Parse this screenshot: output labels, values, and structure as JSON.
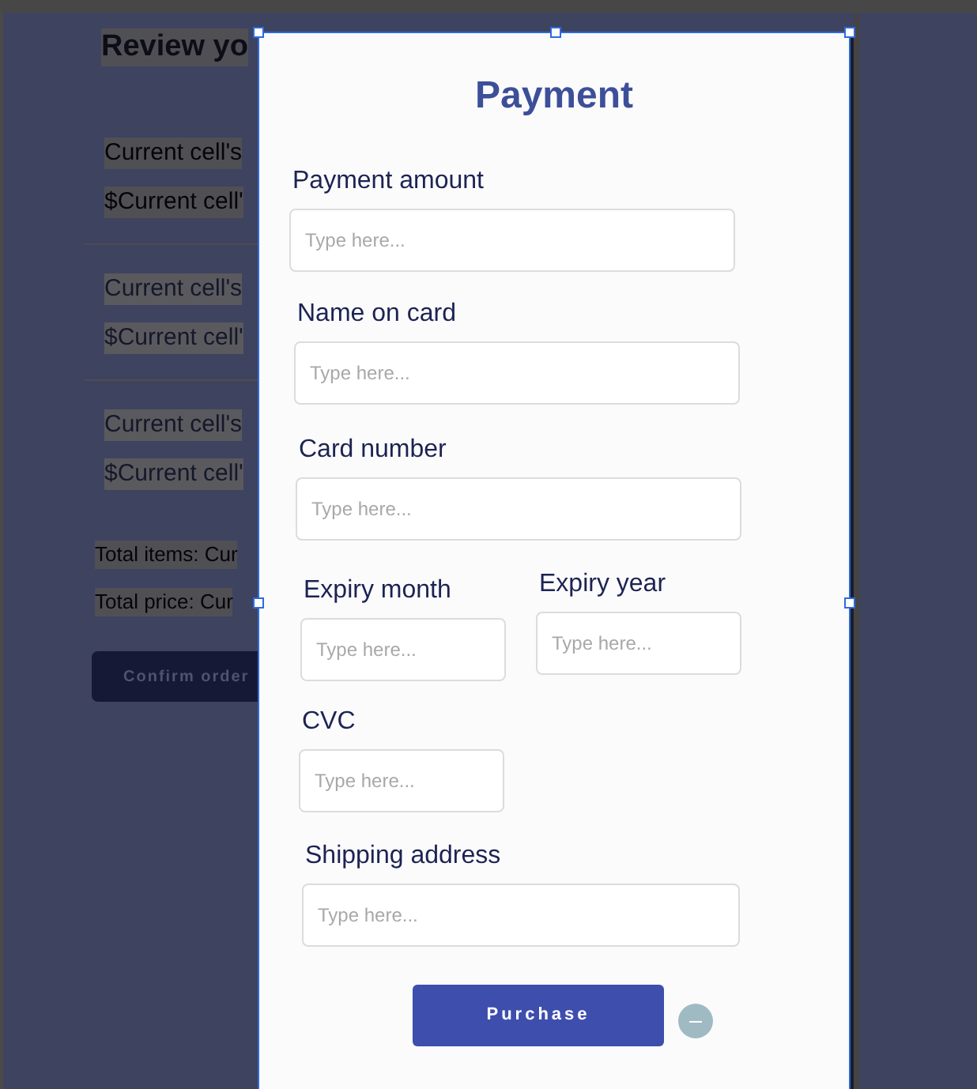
{
  "background_screen": {
    "title": "Review yo",
    "items": [
      {
        "name": "Current cell's",
        "price": "$Current cell'",
        "faded": false
      },
      {
        "name": "Current cell's",
        "price": "$Current cell'",
        "faded": true
      },
      {
        "name": "Current cell's",
        "price": "$Current cell'",
        "faded": true
      }
    ],
    "total_items": "Total items: Cur",
    "total_price": "Total price: Cur",
    "confirm_button": "Confirm order"
  },
  "payment_dialog": {
    "title": "Payment",
    "fields": [
      {
        "label": "Payment amount",
        "placeholder": "Type here...",
        "kind": "full"
      },
      {
        "label": "Name on card",
        "placeholder": "Type here...",
        "kind": "full"
      },
      {
        "label": "Card number",
        "placeholder": "Type here...",
        "kind": "full"
      },
      {
        "label": "Expiry month",
        "placeholder": "Type here...",
        "kind": "half"
      },
      {
        "label": "Expiry year",
        "placeholder": "Type here...",
        "kind": "half"
      },
      {
        "label": "CVC",
        "placeholder": "Type here...",
        "kind": "half"
      },
      {
        "label": "Shipping address",
        "placeholder": "Type here...",
        "kind": "full"
      }
    ],
    "purchase_button": "Purchase"
  }
}
